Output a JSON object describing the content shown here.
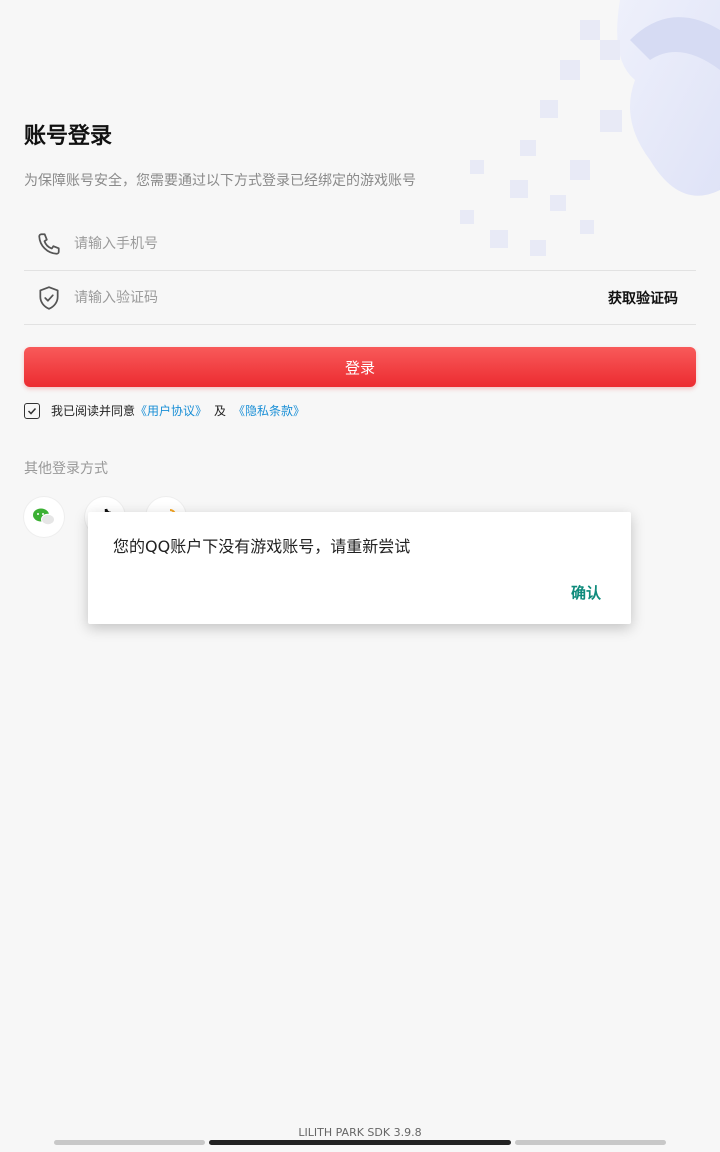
{
  "header": {
    "title": "账号登录",
    "subtitle": "为保障账号安全，您需要通过以下方式登录已经绑定的游戏账号"
  },
  "form": {
    "phone_placeholder": "请输入手机号",
    "code_placeholder": "请输入验证码",
    "get_code_label": "获取验证码",
    "login_label": "登录",
    "accent_color": "#ec2b30"
  },
  "agreement": {
    "checked": true,
    "prefix": "我已阅读并同意",
    "user_agreement": "《用户协议》",
    "and": "及",
    "privacy_policy": "《隐私条款》",
    "link_color": "#1a8fd6"
  },
  "other_login": {
    "label": "其他登录方式",
    "providers": [
      "wechat-icon",
      "tiktok-icon",
      "weibo-icon"
    ]
  },
  "dialog": {
    "message": "您的QQ账户下没有游戏账号，请重新尝试",
    "confirm_label": "确认",
    "confirm_color": "#0f8b7c"
  },
  "footer": {
    "version": "LILITH PARK SDK 3.9.8"
  }
}
